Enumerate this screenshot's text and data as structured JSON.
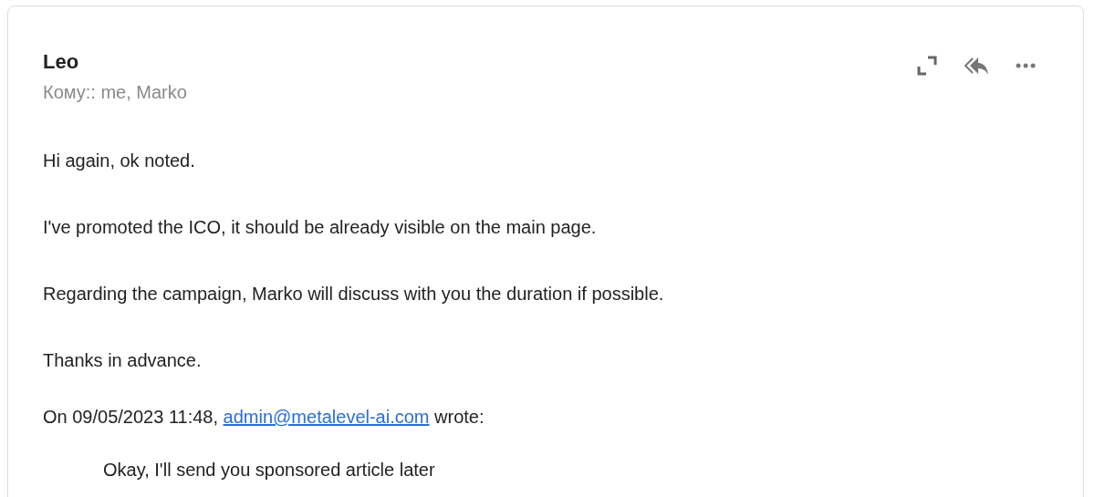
{
  "sender": "Leo",
  "recipients": "Кому:: me, Marko",
  "body": [
    "Hi again, ok noted.",
    "I've promoted the ICO, it should be already visible on the main page.",
    "Regarding the campaign, Marko will discuss with you the duration if possible.",
    "Thanks in advance."
  ],
  "quote_header": {
    "prefix": "On 09/05/2023 11:48,",
    "link": "admin@metalevel-ai.com",
    "suffix": "wrote:"
  },
  "quoted": "Okay, I'll send you sponsored article later"
}
